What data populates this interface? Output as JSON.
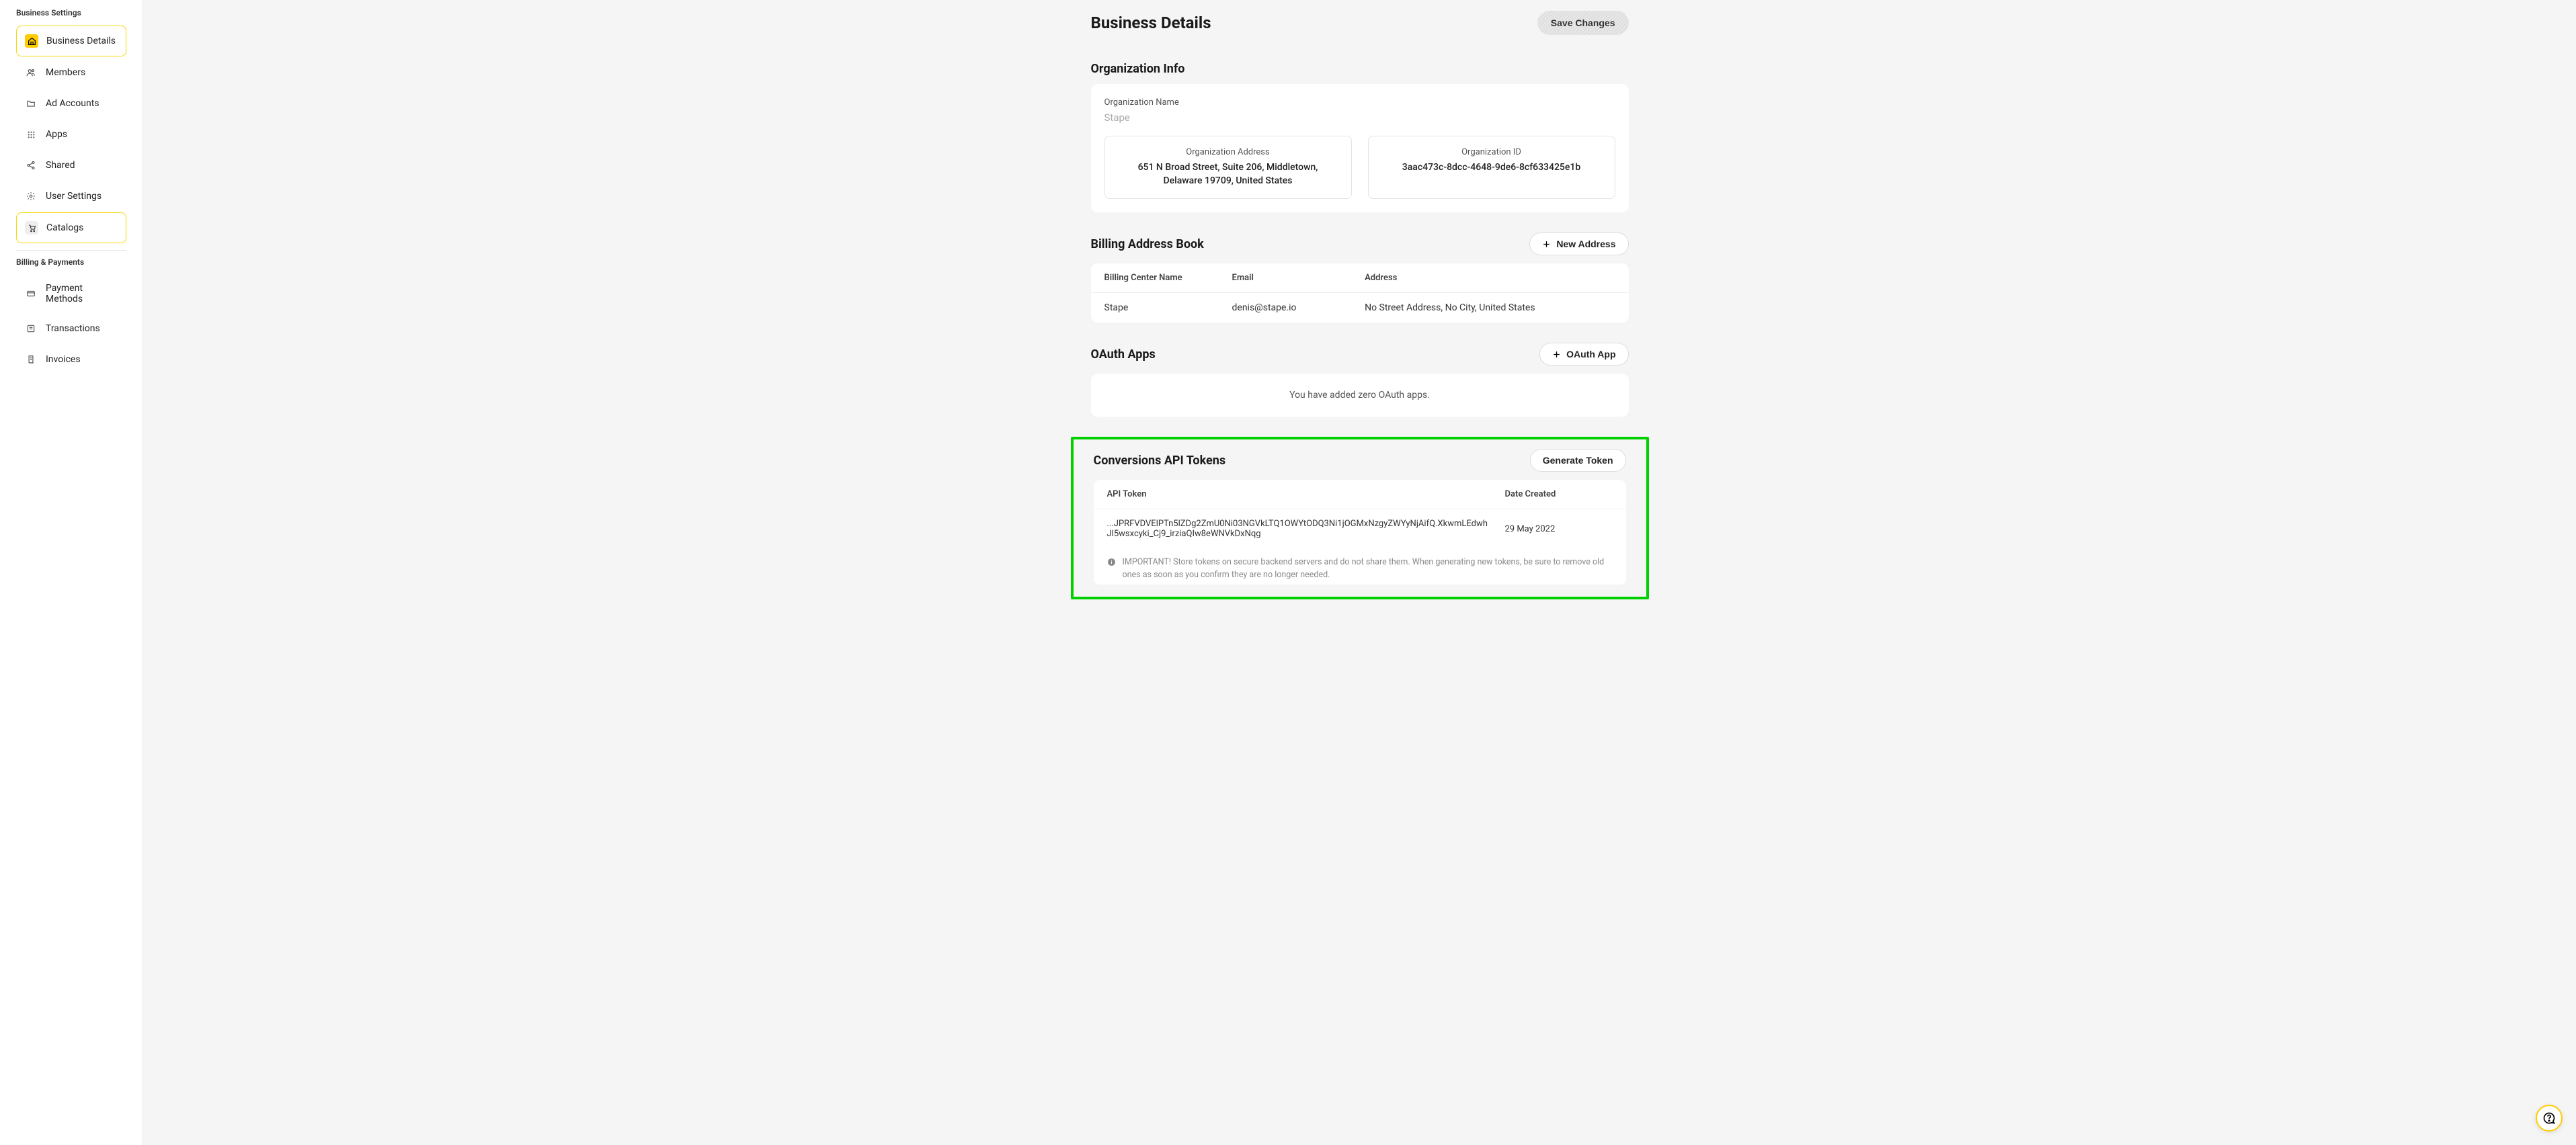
{
  "sidebar": {
    "section1_title": "Business Settings",
    "section2_title": "Billing & Payments",
    "items": [
      {
        "label": "Business Details"
      },
      {
        "label": "Members"
      },
      {
        "label": "Ad Accounts"
      },
      {
        "label": "Apps"
      },
      {
        "label": "Shared"
      },
      {
        "label": "User Settings"
      },
      {
        "label": "Catalogs"
      },
      {
        "label": "Payment Methods"
      },
      {
        "label": "Transactions"
      },
      {
        "label": "Invoices"
      }
    ]
  },
  "header": {
    "title": "Business Details",
    "save_label": "Save Changes"
  },
  "org_info": {
    "section_title": "Organization Info",
    "name_label": "Organization Name",
    "name_value": "Stape",
    "address_label": "Organization Address",
    "address_value": "651 N Broad Street, Suite 206, Middletown, Delaware 19709, United States",
    "id_label": "Organization ID",
    "id_value": "3aac473c-8dcc-4648-9de6-8cf633425e1b"
  },
  "billing": {
    "section_title": "Billing Address Book",
    "new_address_label": "New Address",
    "col_name": "Billing Center Name",
    "col_email": "Email",
    "col_address": "Address",
    "rows": [
      {
        "name": "Stape",
        "email": "denis@stape.io",
        "address": "No Street Address, No City, United States"
      }
    ]
  },
  "oauth": {
    "section_title": "OAuth Apps",
    "add_label": "OAuth App",
    "empty_text": "You have added zero OAuth apps."
  },
  "tokens": {
    "section_title": "Conversions API Tokens",
    "generate_label": "Generate Token",
    "col_token": "API Token",
    "col_date": "Date Created",
    "rows": [
      {
        "token": "...JPRFVDVElPTn5lZDg2ZmU0Ni03NGVkLTQ1OWYtODQ3Ni1jOGMxNzgyZWYyNjAifQ.XkwmLEdwhJl5wsxcyki_Cj9_irziaQIw8eWNVkDxNqg",
        "date": "29 May 2022"
      }
    ],
    "note": "IMPORTANT! Store tokens on secure backend servers and do not share them. When generating new tokens, be sure to remove old ones as soon as you confirm they are no longer needed."
  }
}
